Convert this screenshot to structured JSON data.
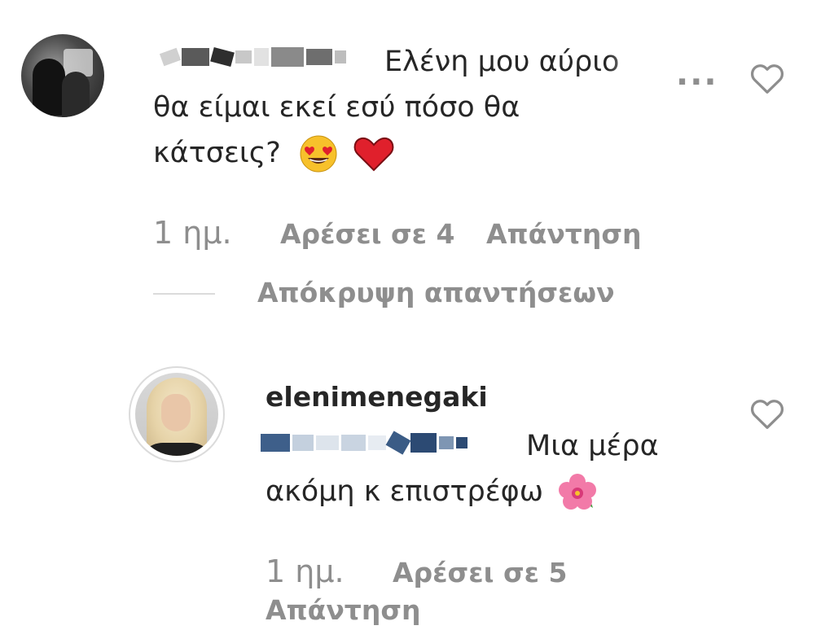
{
  "comment1": {
    "text_line1": "Ελένη μου αύριο",
    "text_line2": "θα είμαι εκεί εσύ πόσο θα",
    "text_line3": "κάτσεις?",
    "emojis": [
      "heart-eyes-emoji",
      "red-heart-emoji"
    ],
    "time": "1 ημ.",
    "likes": "Αρέσει σε 4",
    "reply": "Απάντηση",
    "more": "...",
    "hide_replies": "Απόκρυψη απαντήσεων"
  },
  "reply1": {
    "username": "elenimenegaki",
    "text_line1": "Μια μέρα",
    "text_line2": "ακόμη κ επιστρέφω",
    "emojis": [
      "hibiscus-emoji"
    ],
    "time": "1 ημ.",
    "likes": "Αρέσει σε 5",
    "reply": "Απάντηση"
  },
  "colors": {
    "text": "#262626",
    "secondary": "#8e8e8e",
    "divider": "#dbdbdb",
    "heart_emoji": "#e0202c",
    "smiley": "#f7c12b"
  }
}
